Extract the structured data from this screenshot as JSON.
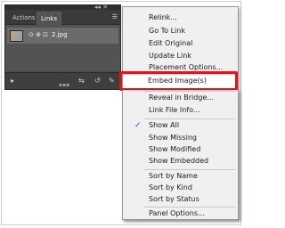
{
  "panel": {
    "controls": "◂◂ ✕",
    "tabs": [
      {
        "label": "Actions"
      },
      {
        "label": "Links"
      }
    ],
    "menu_icon": "☰",
    "item": {
      "status_icons": "⊙ ⊗ ⊡",
      "filename": "2.jpg"
    },
    "bottom_icons": [
      "▸",
      "⇆",
      "↺",
      "✎"
    ]
  },
  "menu": {
    "items": [
      {
        "label": "Relink..."
      },
      {
        "label": "Go To Link"
      },
      {
        "label": "Edit Original"
      },
      {
        "label": "Update Link"
      },
      {
        "label": "Placement Options..."
      },
      {
        "label": "Embed Image(s)"
      },
      {
        "label": "Reveal in Bridge..."
      },
      {
        "label": "Link File Info..."
      },
      {
        "label": "Show All"
      },
      {
        "label": "Show Missing"
      },
      {
        "label": "Show Modified"
      },
      {
        "label": "Show Embedded"
      },
      {
        "label": "Sort by Name"
      },
      {
        "label": "Sort by Kind"
      },
      {
        "label": "Sort by Status"
      },
      {
        "label": "Panel Options..."
      }
    ],
    "checked_mark": "✓",
    "highlight_color": "#e0141c"
  }
}
